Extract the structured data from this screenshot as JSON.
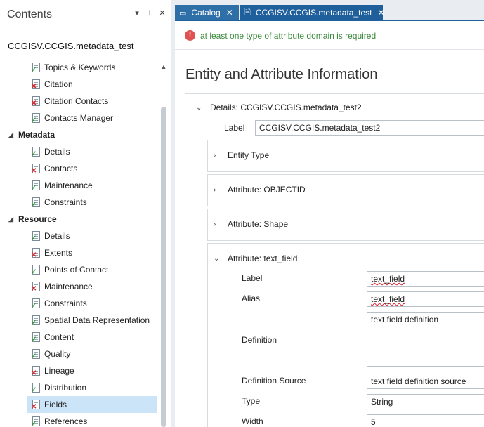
{
  "contents_pane": {
    "title": "Contents",
    "controls": [
      "▾",
      "📌",
      "✕"
    ],
    "item_title": "CCGISV.CCGIS.metadata_test",
    "tree": [
      {
        "label": "Topics & Keywords",
        "status": "ok",
        "level": 2
      },
      {
        "label": "Citation",
        "status": "error",
        "level": 2
      },
      {
        "label": "Citation Contacts",
        "status": "error",
        "level": 2
      },
      {
        "label": "Contacts Manager",
        "status": "ok",
        "level": 2
      },
      {
        "label": "Metadata",
        "group": true
      },
      {
        "label": "Details",
        "status": "ok",
        "level": 2
      },
      {
        "label": "Contacts",
        "status": "error",
        "level": 2
      },
      {
        "label": "Maintenance",
        "status": "ok",
        "level": 2
      },
      {
        "label": "Constraints",
        "status": "ok",
        "level": 2
      },
      {
        "label": "Resource",
        "group": true
      },
      {
        "label": "Details",
        "status": "ok",
        "level": 2
      },
      {
        "label": "Extents",
        "status": "error",
        "level": 2
      },
      {
        "label": "Points of Contact",
        "status": "ok",
        "level": 2
      },
      {
        "label": "Maintenance",
        "status": "error",
        "level": 2
      },
      {
        "label": "Constraints",
        "status": "ok",
        "level": 2
      },
      {
        "label": "Spatial Data Representation",
        "status": "ok",
        "level": 2
      },
      {
        "label": "Content",
        "status": "ok",
        "level": 2
      },
      {
        "label": "Quality",
        "status": "ok",
        "level": 2
      },
      {
        "label": "Lineage",
        "status": "error",
        "level": 2
      },
      {
        "label": "Distribution",
        "status": "ok",
        "level": 2
      },
      {
        "label": "Fields",
        "status": "error",
        "level": 2,
        "selected": true
      },
      {
        "label": "References",
        "status": "ok",
        "level": 2
      }
    ]
  },
  "tabs": {
    "catalog": "Catalog",
    "active": "CCGISV.CCGIS.metadata_test"
  },
  "editor": {
    "warning": "at least one type of attribute domain is required",
    "heading": "Entity and Attribute Information",
    "details_header": "Details:  CCGISV.CCGIS.metadata_test2",
    "label_caption": "Label",
    "label_value": "CCGISV.CCGIS.metadata_test2",
    "entity_type": "Entity Type",
    "attr_objectid": "Attribute:  OBJECTID",
    "attr_shape": "Attribute:  Shape",
    "attr_text_field": "Attribute:  text_field",
    "fields": {
      "label_caption": "Label",
      "label_value": "text_field",
      "alias_caption": "Alias",
      "alias_value": "text_field",
      "definition_caption": "Definition",
      "definition_value": "text field definition",
      "def_source_caption": "Definition Source",
      "def_source_value": "text field definition source",
      "type_caption": "Type",
      "type_value": "String",
      "width_caption": "Width",
      "width_value": "5"
    }
  },
  "colors": {
    "tab_active": "#1f5f9b",
    "tab_inactive": "#2f6fa7",
    "selected_row": "#cce4f7",
    "warning_icon": "#e05252",
    "warning_text": "#3c8a3c",
    "ok_mark": "#2e9a38",
    "error_mark": "#d7262c"
  }
}
